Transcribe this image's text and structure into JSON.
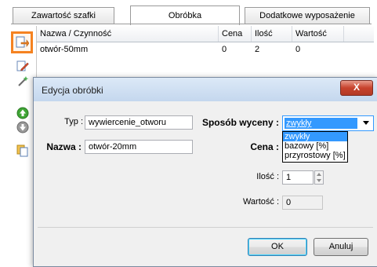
{
  "tabs": [
    {
      "label": "Zawartość szafki",
      "active": false
    },
    {
      "label": "Obróbka",
      "active": true
    },
    {
      "label": "Dodatkowe wyposażenie",
      "active": false
    }
  ],
  "toolbar": {
    "icons": [
      "add-item-icon",
      "edit-icon",
      "magic-wand-icon",
      "move-up-icon",
      "move-down-icon",
      "copy-icon"
    ],
    "selected": "add-item-icon",
    "accent": "#f58220"
  },
  "grid": {
    "columns": [
      "Nazwa / Czynność",
      "Cena",
      "Ilość",
      "Wartość"
    ],
    "rows": [
      [
        "otwór-50mm",
        "0",
        "2",
        "0"
      ]
    ]
  },
  "dialog": {
    "title": "Edycja obróbki",
    "close_label": "X",
    "typ_label": "Typ :",
    "typ_value": "wywiercenie_otworu",
    "nazwa_label": "Nazwa :",
    "nazwa_value": "otwór-20mm",
    "sposob_label": "Sposób wyceny :",
    "sposob_value": "zwykły",
    "sposob_options": [
      "zwykły",
      "bazowy [%]",
      "przyrostowy [%]"
    ],
    "cena_label": "Cena :",
    "ilosc_label": "Ilość :",
    "ilosc_value": "1",
    "wartosc_label": "Wartość :",
    "wartosc_value": "0",
    "ok_label": "OK",
    "cancel_label": "Anuluj"
  }
}
